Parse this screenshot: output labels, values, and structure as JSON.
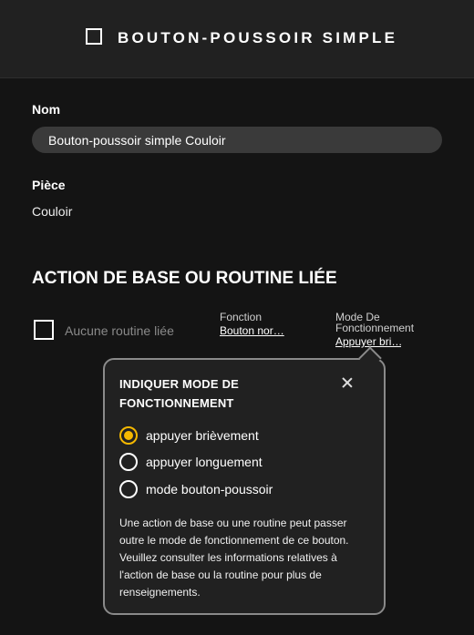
{
  "header": {
    "title": "BOUTON-POUSSOIR SIMPLE",
    "icon": "square-outline-icon"
  },
  "form": {
    "name_label": "Nom",
    "name_value": "Bouton-poussoir simple Couloir",
    "room_label": "Pièce",
    "room_value": "Couloir"
  },
  "section": {
    "title": "ACTION DE BASE OU ROUTINE LIÉE",
    "routine_label": "Aucune routine liée",
    "function_label": "Fonction",
    "function_value": "Bouton nor…",
    "mode_label_line1": "Mode De",
    "mode_label_line2": "Fonctionnement",
    "mode_value": "Appuyer bri…"
  },
  "popover": {
    "title": "INDIQUER MODE DE FONCTIONNEMENT",
    "options": [
      {
        "label": "appuyer brièvement",
        "selected": true
      },
      {
        "label": "appuyer longuement",
        "selected": false
      },
      {
        "label": "mode bouton-poussoir",
        "selected": false
      }
    ],
    "description": "Une action de base ou une routine peut passer outre le mode de fonctionnement de ce bouton. Veuillez consulter les informations relatives à l'action de base ou la routine pour plus de renseignements."
  },
  "colors": {
    "accent": "#f5b800",
    "background": "#141414",
    "header": "#212121",
    "input": "#3a3a3a"
  }
}
